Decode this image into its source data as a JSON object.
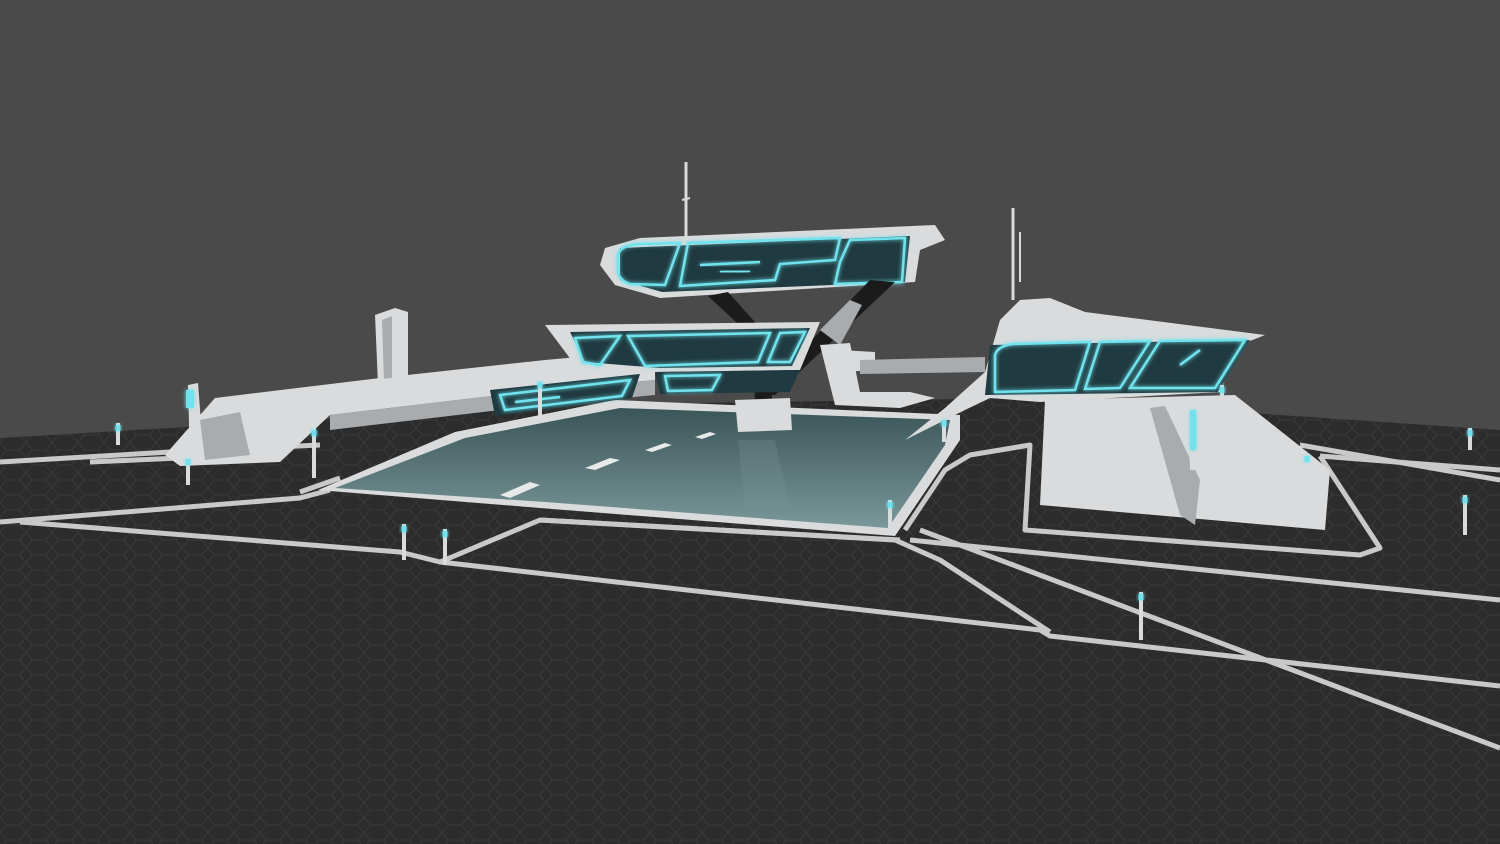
{
  "scene": {
    "background_color": "#4a4a4a",
    "ground_color": "#2c2c2c",
    "hex_line_color": "#3b3b3b",
    "road_line_color": "#c9c9c9",
    "structure_color": "#d9dbdc",
    "structure_shadow_color": "#a9acae",
    "glass_color": "#1f3a40",
    "neon_color": "#6fe3ee",
    "water_color": "#3a5558",
    "water_highlight_color": "#7a979a",
    "dark_support_color": "#1b1b1b"
  }
}
